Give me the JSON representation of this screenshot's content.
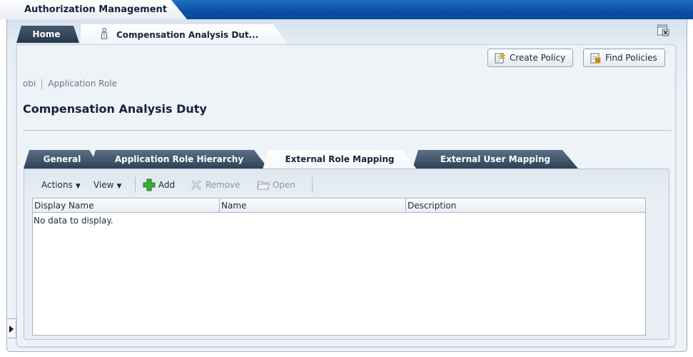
{
  "app": {
    "title": "Authorization Management"
  },
  "tabs": {
    "home_label": "Home",
    "duty_label": "Compensation Analysis Dut..."
  },
  "actions": {
    "create_policy": "Create Policy",
    "find_policies": "Find Policies"
  },
  "breadcrumb": {
    "first": "obi",
    "second": "Application Role"
  },
  "page": {
    "title": "Compensation Analysis Duty"
  },
  "subtabs": {
    "general": "General",
    "hierarchy": "Application Role Hierarchy",
    "external_role": "External Role Mapping",
    "external_user": "External User Mapping"
  },
  "toolbar": {
    "actions": "Actions",
    "view": "View",
    "add": "Add",
    "remove": "Remove",
    "open": "Open"
  },
  "table": {
    "columns": [
      "Display Name",
      "Name",
      "Description"
    ],
    "empty_message": "No data to display."
  },
  "icons": {
    "person": "person-icon",
    "close": "close-tab-icon",
    "create_policy": "create-policy-icon",
    "find_policies": "find-policies-icon",
    "add": "plus-icon",
    "remove": "remove-x-icon",
    "open": "folder-open-icon",
    "side": "expand-arrow-icon"
  },
  "colors": {
    "header_blue": "#0b4fa3",
    "add_green": "#2ea82e",
    "dark_tab": "#2f4156"
  }
}
